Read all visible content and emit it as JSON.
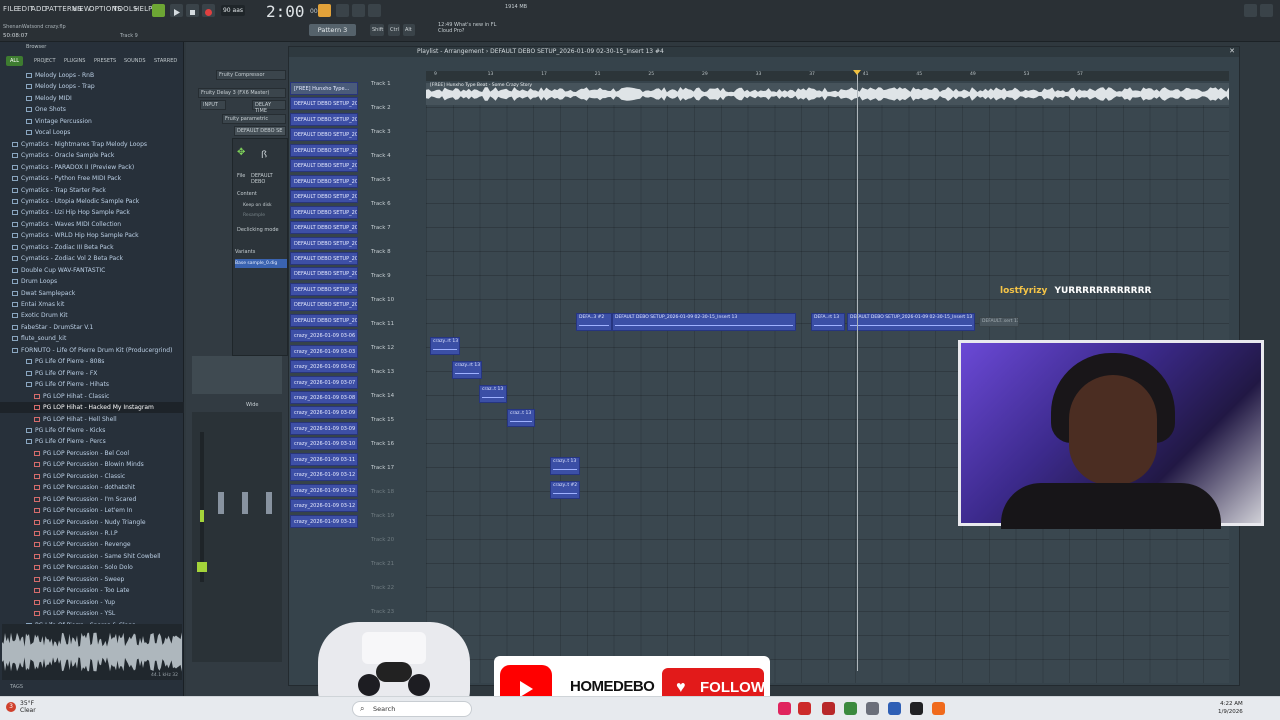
{
  "menu": [
    "FILE",
    "EDIT",
    "ADD",
    "PATTERNS",
    "VIEW",
    "OPTIONS",
    "TOOLS",
    "HELP"
  ],
  "hint_text": "ShenanWatsond crazy.flp",
  "counter": "50:08:07",
  "track_hint": "Track 9",
  "tempo": "90 aas",
  "time_display": "2:00",
  "time_sub": "00",
  "pattern": "Pattern 3",
  "news": [
    "12:49 What's new in FL",
    "Cloud Pro?"
  ],
  "cpu": "1914 MB",
  "browser": {
    "header": "Browser",
    "tabs": [
      "ALL",
      "PROJECT",
      "PLUGINS",
      "PRESETS",
      "SOUNDS",
      "STARRED"
    ],
    "items": [
      "Melody Loops - RnB",
      "Melody Loops - Trap",
      "Melody MIDI",
      "One Shots",
      "Vintage Percussion",
      "Vocal Loops",
      "Cymatics - Nightmares Trap Melody Loops",
      "Cymatics - Oracle Sample Pack",
      "Cymatics - PARADOX II (Preview Pack)",
      "Cymatics - Python Free MIDI Pack",
      "Cymatics - Trap Starter Pack",
      "Cymatics - Utopia Melodic Sample Pack",
      "Cymatics - Uzi Hip Hop Sample Pack",
      "Cymatics - Waves MIDI Collection",
      "Cymatics - WRLD Hip Hop Sample Pack",
      "Cymatics - Zodiac III Beta Pack",
      "Cymatics - Zodiac Vol 2 Beta Pack",
      "Double Cup WAV-FANTASTIC",
      "Drum Loops",
      "Dwat Samplepack",
      "Entai Xmas kit",
      "Exotic Drum Kit",
      "FabeStar - DrumStar V.1",
      "flute_sound_kit",
      "FORNUTO - Life Of Pierre Drum Kit (Producergrind)",
      "PG Life Of Pierre - 808s",
      "PG Life Of Pierre - FX",
      "PG Life Of Pierre - Hihats",
      "PG LOP Hihat - Classic",
      "PG LOP Hihat - Hacked My Instagram",
      "PG LOP Hihat - Hell Shell",
      "PG Life Of Pierre - Kicks",
      "PG Life Of Pierre - Percs",
      "PG LOP Percussion - Bel Cool",
      "PG LOP Percussion - Blowin Minds",
      "PG LOP Percussion - Classic",
      "PG LOP Percussion - dothatshit",
      "PG LOP Percussion - I'm Scared",
      "PG LOP Percussion - Let'em In",
      "PG LOP Percussion - Nudy Triangle",
      "PG LOP Percussion - R.I.P",
      "PG LOP Percussion - Revenge",
      "PG LOP Percussion - Same Shit Cowbell",
      "PG LOP Percussion - Solo Dolo",
      "PG LOP Percussion - Sweep",
      "PG LOP Percussion - Too Late",
      "PG LOP Percussion - Yup",
      "PG LOP Percussion - YSL",
      "PG Life Of Pierre - Snares & Claps",
      "PG Life Of Pierre - Vox"
    ],
    "selected_index": 29,
    "sample_info": "44.1 kHz 32",
    "tags_label": "TAGS"
  },
  "plugins": {
    "compressor": "Fruity Compressor",
    "delay": "Fruity Delay 3 (FX6 Master)",
    "parametric": "Fruity parametric",
    "slicer_title": "DEFAULT DEBO SE",
    "file_label": "File",
    "file_value": "DEFAULT DEBO",
    "content_label": "Content",
    "keep_on_disk": "Keep on disk",
    "resample": "Resample",
    "declick": "Declicking mode",
    "variants": "Variants",
    "base_sample": "Base sample_0.dig",
    "wide": "Wide",
    "input": "INPUT",
    "delay_label": "DELAY TIME"
  },
  "channels": [
    "[FREE] Hunxho Type...",
    "DEFAULT DEBO SETUP_202",
    "DEFAULT DEBO SETUP_202",
    "DEFAULT DEBO SETUP_202",
    "DEFAULT DEBO SETUP_202",
    "DEFAULT DEBO SETUP_202",
    "DEFAULT DEBO SETUP_202",
    "DEFAULT DEBO SETUP_202",
    "DEFAULT DEBO SETUP_202",
    "DEFAULT DEBO SETUP_202",
    "DEFAULT DEBO SETUP_202",
    "DEFAULT DEBO SETUP_202",
    "DEFAULT DEBO SETUP_202",
    "DEFAULT DEBO SETUP_202",
    "DEFAULT DEBO SETUP_202",
    "DEFAULT DEBO SETUP_202",
    "crazy_2026-01-09 03-06",
    "crazy_2026-01-09 03-03",
    "crazy_2026-01-09 03-02",
    "crazy_2026-01-09 03-07",
    "crazy_2026-01-09 03-08",
    "crazy_2026-01-09 03-09",
    "crazy_2026-01-09 03-09",
    "crazy_2026-01-09 03-10",
    "crazy_2026-01-09 03-11",
    "crazy_2026-01-09 03-12",
    "crazy_2026-01-09 03-12",
    "crazy_2026-01-09 03-12",
    "crazy_2026-01-09 03-13"
  ],
  "playlist": {
    "title": "Playlist - Arrangement › DEFAULT DEBO SETUP_2026-01-09 02-30-15_Insert 13 #4",
    "ruler": [
      "9",
      "13",
      "17",
      "21",
      "25",
      "29",
      "33",
      "37",
      "41",
      "45",
      "49",
      "53",
      "57"
    ],
    "tracks": [
      "Track 1",
      "Track 2",
      "Track 3",
      "Track 4",
      "Track 5",
      "Track 6",
      "Track 7",
      "Track 8",
      "Track 9",
      "Track 10",
      "Track 11",
      "Track 12",
      "Track 13",
      "Track 14",
      "Track 15",
      "Track 16",
      "Track 17",
      "Track 18",
      "Track 19",
      "Track 20",
      "Track 21",
      "Track 22",
      "Track 23"
    ],
    "audio_clip_label": "[FREE] Hunxho Type Beat - Some Crazy Story",
    "clips": [
      {
        "label": "DEFA..3 #2",
        "track": 9
      },
      {
        "label": "DEFAULT DEBO SETUP_2026-01-09 02-30-15_Insert 13",
        "track": 9
      },
      {
        "label": "DEFA..rt 13",
        "track": 9
      },
      {
        "label": "DEFAULT DEBO SETUP_2026-01-09 02-30-15_Insert 13",
        "track": 9
      },
      {
        "label": "crazy..rt 13",
        "track": 10
      },
      {
        "label": "crazy..rt 13",
        "track": 11
      },
      {
        "label": "craz..t 13",
        "track": 12
      },
      {
        "label": "craz..t 13",
        "track": 13
      },
      {
        "label": "crazy..t 13",
        "track": 15
      },
      {
        "label": "crazy..t #2",
        "track": 16
      }
    ],
    "ghost_clip": "DEFAULT..sert 13"
  },
  "chat": {
    "user": "lostfyrizy",
    "message": "YURRRRRRRRRRRR"
  },
  "overlay": {
    "handle": "HOMEDEBO",
    "follow": "FOLLOW"
  },
  "taskbar": {
    "weather_temp": "35°F",
    "weather_desc": "Clear",
    "search_placeholder": "Search",
    "time": "4:22 AM",
    "date": "1/9/2026",
    "notification_count": "3"
  },
  "colors": {
    "clip": "#3b4fa6",
    "accent_green": "#3e7c30",
    "follow_red": "#e21a1a",
    "youtube_red": "#ff0000",
    "chat_user": "#f5c447"
  }
}
